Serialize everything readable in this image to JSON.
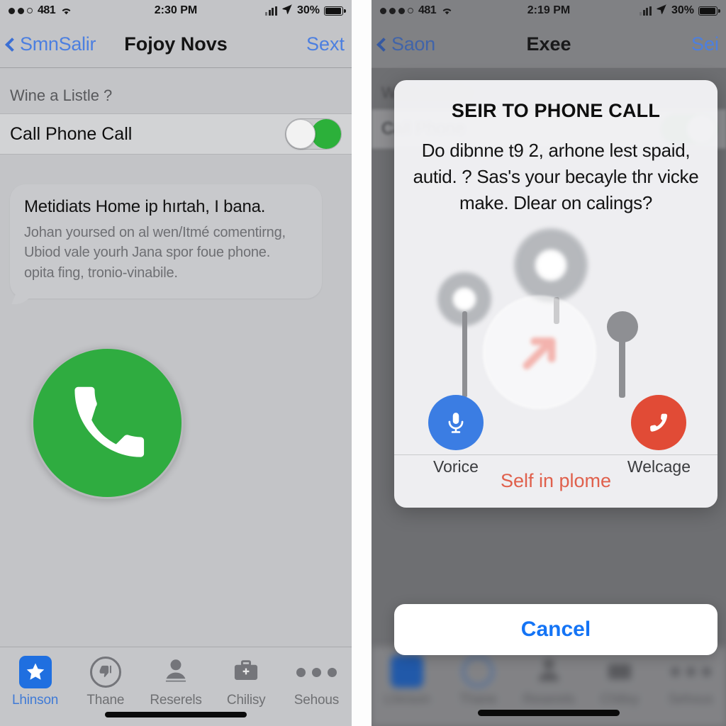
{
  "left_panel": {
    "status_bar": {
      "signal_dots": "●●○",
      "carrier": "481",
      "wifi_icon": "wifi-icon",
      "time": "2:30 PM",
      "cellular_icon": "cellular-bars-icon",
      "location_icon": "location-arrow-icon",
      "battery_percent": "30%",
      "battery_icon": "battery-icon"
    },
    "nav_bar": {
      "back_icon": "chevron-left-icon",
      "back_label": "SmnSalir",
      "title": "Fojoy Novs",
      "action_label": "Sext"
    },
    "section_header": "Wine a Listle ?",
    "setting_row": {
      "label": "Call Phone Call",
      "toggle_state": "on",
      "toggle_color": "#2cb03a"
    },
    "message_bubble": {
      "title": "Metidiats Home ip hırtah, I bana.",
      "line1": "Johan yoursed on al wen/Itmé comentirng,",
      "line2": "Ubiod vale yourh Jana spor foue phone.",
      "line3": "opita fing, tronio-vinabile."
    },
    "call_button": {
      "icon": "phone-handset-icon",
      "color": "#2fac40"
    },
    "tab_bar": [
      {
        "label": "Lhinson",
        "icon": "star-icon",
        "active": true
      },
      {
        "label": "Thane",
        "icon": "thumbs-down-circle-icon",
        "active": false
      },
      {
        "label": "Reserels",
        "icon": "person-icon",
        "active": false
      },
      {
        "label": "Chilisy",
        "icon": "briefcase-first-aid-icon",
        "active": false
      },
      {
        "label": "Sehous",
        "icon": "more-dots-icon",
        "active": false
      }
    ]
  },
  "right_panel": {
    "status_bar": {
      "signal_dots": "●●●○",
      "carrier": "481",
      "wifi_icon": "wifi-icon",
      "time": "2:19 PM",
      "cellular_icon": "cellular-bars-icon",
      "location_icon": "location-arrow-icon",
      "battery_percent": "30%",
      "battery_icon": "battery-icon"
    },
    "nav_bar": {
      "back_icon": "chevron-left-icon",
      "back_label": "Saon",
      "title": "Exee",
      "action_label": "Sei"
    },
    "background": {
      "section_header": "Wine a Listle",
      "row_label": "Call Phone",
      "toggle_state": "on"
    },
    "dialog": {
      "title": "SEIR TO PHONE CALL",
      "message_line1": "Do dibnne t9 2, arhone lest spaid,",
      "message_line2": "autid. ? Sas's your becayle thr vicke",
      "message_line3": "make. Dlear on calings?",
      "graphic": {
        "center_icon": "arrow-up-right-icon",
        "center_icon_color": "#f08a80",
        "ghost_pins": [
          "pin-icon",
          "pin-icon",
          "pin-icon"
        ]
      },
      "actions": [
        {
          "label": "Vorice",
          "icon": "microphone-icon",
          "color": "#3b7de3"
        },
        {
          "label": "Welcage",
          "icon": "end-call-icon",
          "color": "#e14b36"
        }
      ],
      "destructive_label": "Self in plome",
      "cancel_label": "Cancel"
    }
  }
}
